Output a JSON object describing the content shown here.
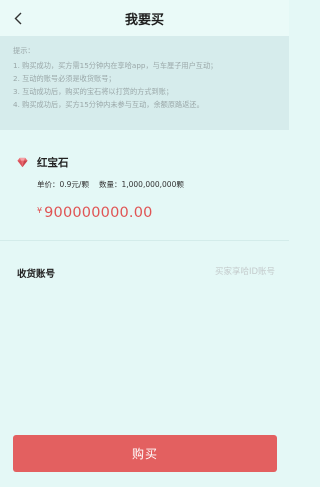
{
  "header": {
    "title": "我要买",
    "back_icon": "chevron-left-icon"
  },
  "notice": {
    "heading": "提示：",
    "lines": [
      "1. 购买成功，买方需15分钟内在享哈app，与车厘子用户互动；",
      "2. 互动的账号必须是收货账号；",
      "3. 互动成功后，购买的宝石将以打赏的方式到账；",
      "4. 购买成功后，买方15分钟内未参与互动，余额原路返还。"
    ]
  },
  "item": {
    "icon": "ruby-gem-icon",
    "name": "红宝石",
    "unit_price": "单价：0.9元/颗",
    "quantity": "数量：1,000,000,000颗",
    "currency_symbol": "¥",
    "total": "900000000.00"
  },
  "account": {
    "label": "收货账号",
    "placeholder": "买家享哈ID账号",
    "value": ""
  },
  "actions": {
    "buy_label": "购买"
  },
  "colors": {
    "background": "#e4f8f6",
    "notice_bg": "#d6ecec",
    "accent_red": "#e36060",
    "price_red": "#e05454"
  }
}
